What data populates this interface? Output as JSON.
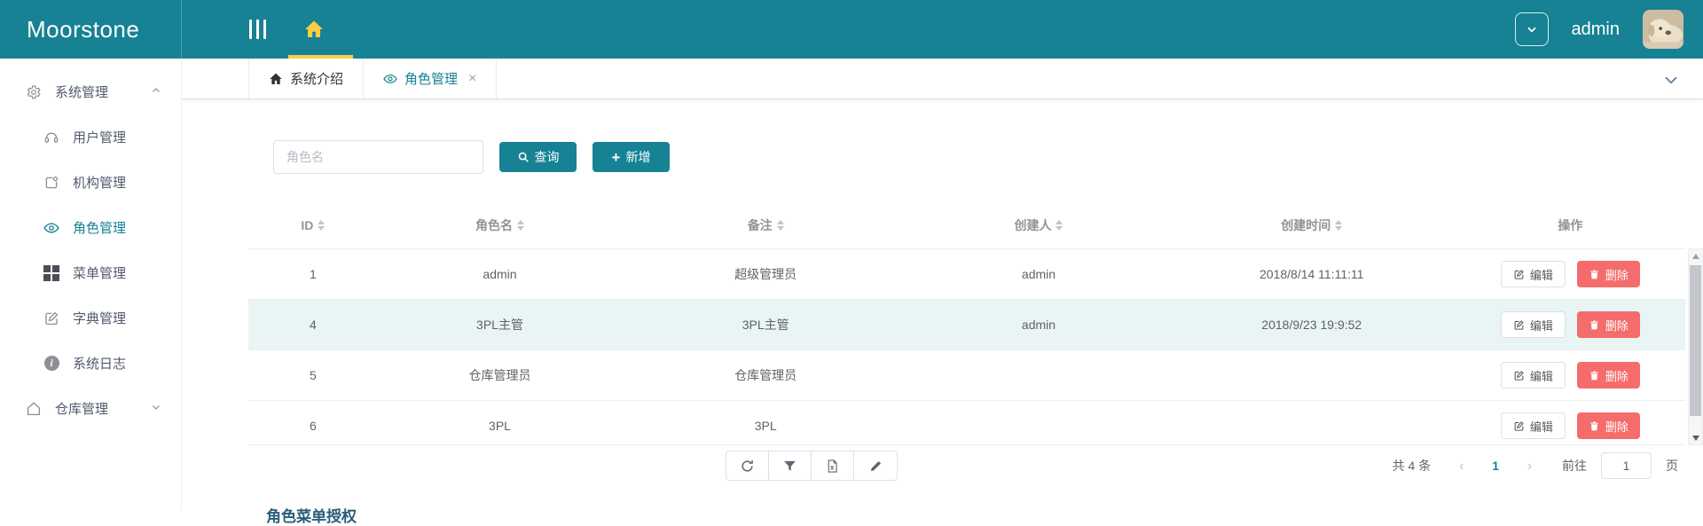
{
  "app": {
    "name": "Moorstone",
    "user": "admin"
  },
  "header": {
    "icons": [
      "collapse-menu-icon",
      "home-icon",
      "chevron-down-icon",
      "avatar"
    ]
  },
  "sidebar": {
    "sections": [
      {
        "label": "系统管理",
        "icon": "gear-icon",
        "expanded": true,
        "children": [
          {
            "label": "用户管理",
            "icon": "headset-icon"
          },
          {
            "label": "机构管理",
            "icon": "org-icon"
          },
          {
            "label": "角色管理",
            "icon": "eye-icon",
            "active": true
          },
          {
            "label": "菜单管理",
            "icon": "grid-icon"
          },
          {
            "label": "字典管理",
            "icon": "edit-square-icon"
          },
          {
            "label": "系统日志",
            "icon": "info-icon"
          }
        ]
      },
      {
        "label": "仓库管理",
        "icon": "house-icon",
        "expanded": false,
        "children": []
      }
    ]
  },
  "tabbar": {
    "tabs": [
      {
        "label": "系统介绍",
        "icon": "home-icon",
        "active": false,
        "closable": false
      },
      {
        "label": "角色管理",
        "icon": "eye-icon",
        "active": true,
        "closable": true
      }
    ]
  },
  "search": {
    "placeholder": "角色名",
    "query_label": "查询",
    "add_label": "新增"
  },
  "table": {
    "columns": [
      {
        "label": "ID",
        "sortable": true
      },
      {
        "label": "角色名",
        "sortable": true
      },
      {
        "label": "备注",
        "sortable": true
      },
      {
        "label": "创建人",
        "sortable": true
      },
      {
        "label": "创建时间",
        "sortable": true
      },
      {
        "label": "操作",
        "sortable": false
      }
    ],
    "rows": [
      {
        "id": "1",
        "role": "admin",
        "remark": "超级管理员",
        "creator": "admin",
        "created": "2018/8/14 11:11:11",
        "highlight": false
      },
      {
        "id": "4",
        "role": "3PL主管",
        "remark": "3PL主管",
        "creator": "admin",
        "created": "2018/9/23 19:9:52",
        "highlight": true
      },
      {
        "id": "5",
        "role": "仓库管理员",
        "remark": "仓库管理员",
        "creator": "",
        "created": "",
        "highlight": false
      },
      {
        "id": "6",
        "role": "3PL",
        "remark": "3PL",
        "creator": "",
        "created": "",
        "highlight": false
      }
    ],
    "edit_label": "编辑",
    "delete_label": "删除"
  },
  "toolbar": {
    "icons": [
      "refresh-icon",
      "filter-icon",
      "excel-export-icon",
      "pencil-icon"
    ]
  },
  "pagination": {
    "total": "共 4 条",
    "current_page": "1",
    "goto_label": "前往",
    "goto_value": "1",
    "unit_label": "页"
  },
  "bottom_section": {
    "title": "角色菜单授权"
  },
  "colors": {
    "teal": "#168294",
    "yellow": "#FACD46",
    "danger": "#F56C6C",
    "row_highlight": "#E9F4F4"
  }
}
